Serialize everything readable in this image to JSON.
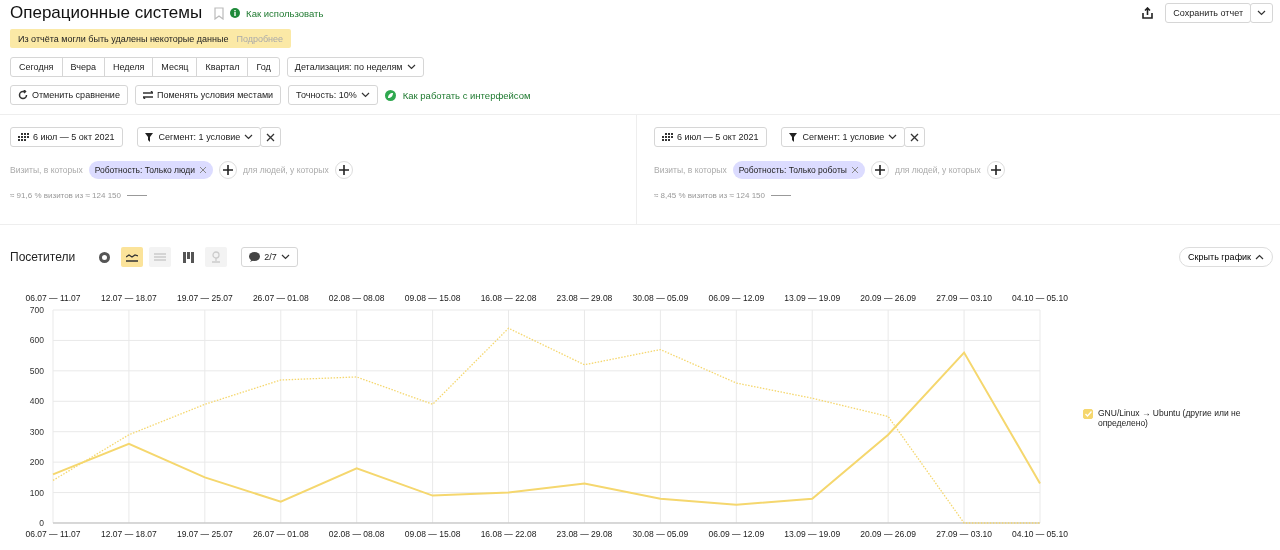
{
  "title": "Операционные системы",
  "help_link": "Как использовать",
  "notice": {
    "text": "Из отчёта могли быть удалены некоторые данные",
    "link": "Подробнее"
  },
  "header_actions": {
    "save": "Сохранить отчет"
  },
  "periods": [
    {
      "label": "Сегодня",
      "selected": false
    },
    {
      "label": "Вчера",
      "selected": false
    },
    {
      "label": "Неделя",
      "selected": false
    },
    {
      "label": "Месяц",
      "selected": false
    },
    {
      "label": "Квартал",
      "selected": false
    },
    {
      "label": "Год",
      "selected": false
    }
  ],
  "detail": "Детализация: по неделям",
  "actions": {
    "cancel": "Отменить сравнение",
    "swap": "Поменять условия местами",
    "accuracy": "Точность: 10%",
    "guide": "Как работать с интерфейсом"
  },
  "segments": [
    {
      "dates": "6 июл — 5 окт 2021",
      "segment": "Сегмент: 1 условие",
      "visits_label": "Визиты, в которых",
      "chip": "Роботность: Только люди",
      "people_label": "для людей, у которых",
      "share": "≈ 91,6 % визитов из ≈ 124 150"
    },
    {
      "dates": "6 июл — 5 окт 2021",
      "segment": "Сегмент: 1 условие",
      "visits_label": "Визиты, в которых",
      "chip": "Роботность: Только роботы",
      "people_label": "для людей, у которых",
      "share": "≈ 8,45 % визитов из ≈ 124 150"
    }
  ],
  "chart_header": {
    "title": "Посетители",
    "views": [
      {
        "kind": "pie",
        "selected": false,
        "disabled": false
      },
      {
        "kind": "line",
        "selected": true,
        "disabled": false
      },
      {
        "kind": "area",
        "selected": false,
        "disabled": true
      },
      {
        "kind": "table",
        "selected": false,
        "disabled": false
      },
      {
        "kind": "map",
        "selected": false,
        "disabled": true
      }
    ],
    "counter": "2/7",
    "hide": "Скрыть график"
  },
  "chart": {
    "chart_data": {
      "type": "line",
      "grid": true,
      "categories": [
        "06.07 — 11.07",
        "12.07 — 18.07",
        "19.07 — 25.07",
        "26.07 — 01.08",
        "02.08 — 08.08",
        "09.08 — 15.08",
        "16.08 — 22.08",
        "23.08 — 29.08",
        "30.08 — 05.09",
        "06.09 — 12.09",
        "13.09 — 19.09",
        "20.09 — 26.09",
        "27.09 — 03.10",
        "04.10 — 05.10"
      ],
      "series": [
        {
          "name": "GNU/Linux → Ubuntu (другие или не определено)",
          "color": "#f5d76e",
          "line_style": "solid",
          "values": [
            160,
            260,
            150,
            70,
            180,
            90,
            100,
            130,
            80,
            60,
            80,
            290,
            560,
            130
          ]
        },
        {
          "color": "#f5d76e",
          "line_style": "dotted",
          "values": [
            140,
            290,
            390,
            470,
            480,
            390,
            640,
            520,
            570,
            460,
            410,
            350,
            0,
            0
          ]
        }
      ],
      "ylim": [
        0,
        700
      ],
      "yticks": [
        0,
        100,
        200,
        300,
        400,
        500,
        600,
        700
      ]
    },
    "legend_checked": true
  }
}
